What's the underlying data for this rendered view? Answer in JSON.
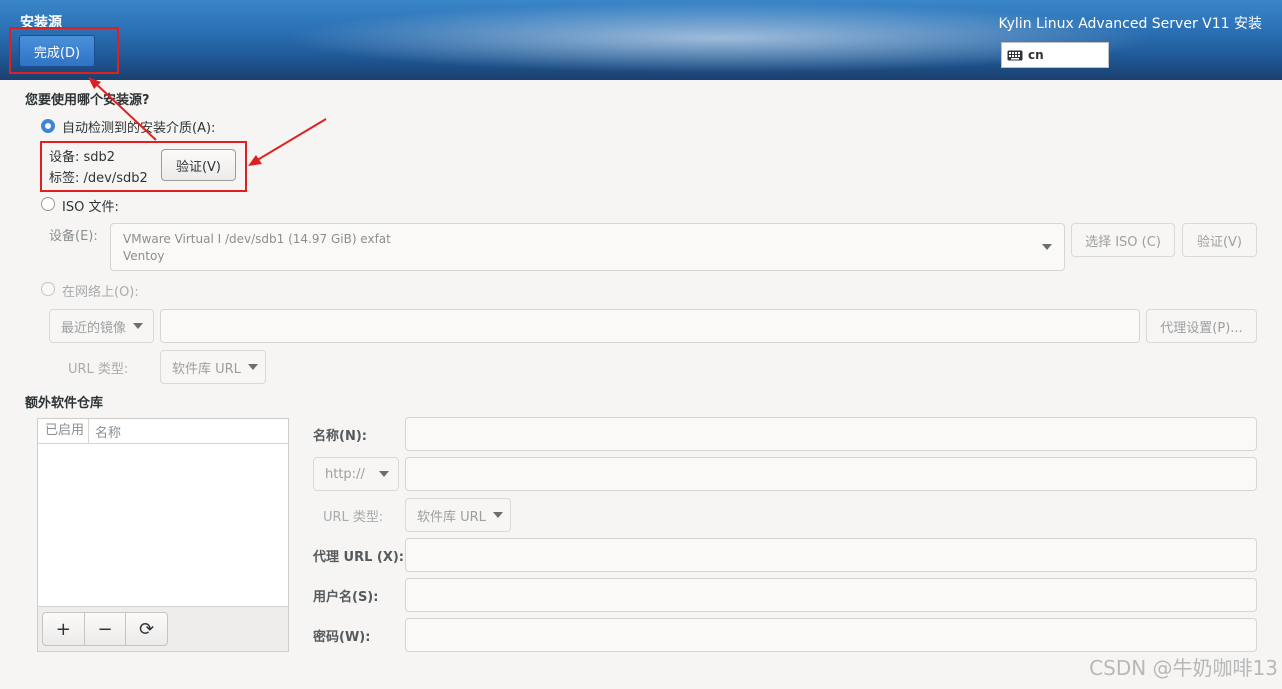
{
  "header": {
    "title": "安装源",
    "done_label": "完成(D)",
    "product": "Kylin Linux Advanced Server V11 安装",
    "keyboard_layout": "cn"
  },
  "source": {
    "question": "您要使用哪个安装源?",
    "auto_label": "自动检测到的安装介质(A):",
    "device_line": "设备:  sdb2",
    "label_line": "标签:  /dev/sdb2",
    "verify_label": "验证(V)",
    "iso_label": "ISO 文件:",
    "device_field_label": "设备(E):",
    "device_selected_line1": "VMware Virtual I /dev/sdb1 (14.97 GiB) exfat",
    "device_selected_line2": "Ventoy",
    "choose_iso_label": "选择 ISO (C)",
    "iso_verify_label": "验证(V)",
    "network_label": "在网络上(O):",
    "mirror_option": "最近的镜像",
    "proxy_button": "代理设置(P)...",
    "url_type_label": "URL 类型:",
    "url_type_value": "软件库 URL"
  },
  "repos": {
    "section_title": "额外软件仓库",
    "col_enabled": "已启用",
    "col_name": "名称",
    "add_symbol": "+",
    "remove_symbol": "−",
    "refresh_symbol": "⟳",
    "name_label": "名称(N):",
    "protocol_value": "http://",
    "url_type_label": "URL 类型:",
    "url_type_value": "软件库 URL",
    "proxy_url_label": "代理 URL (X):",
    "username_label": "用户名(S):",
    "password_label": "密码(W):"
  },
  "watermark": "CSDN @牛奶咖啡13",
  "colors": {
    "accent": "#3d86d7",
    "annotation": "#e02020"
  }
}
